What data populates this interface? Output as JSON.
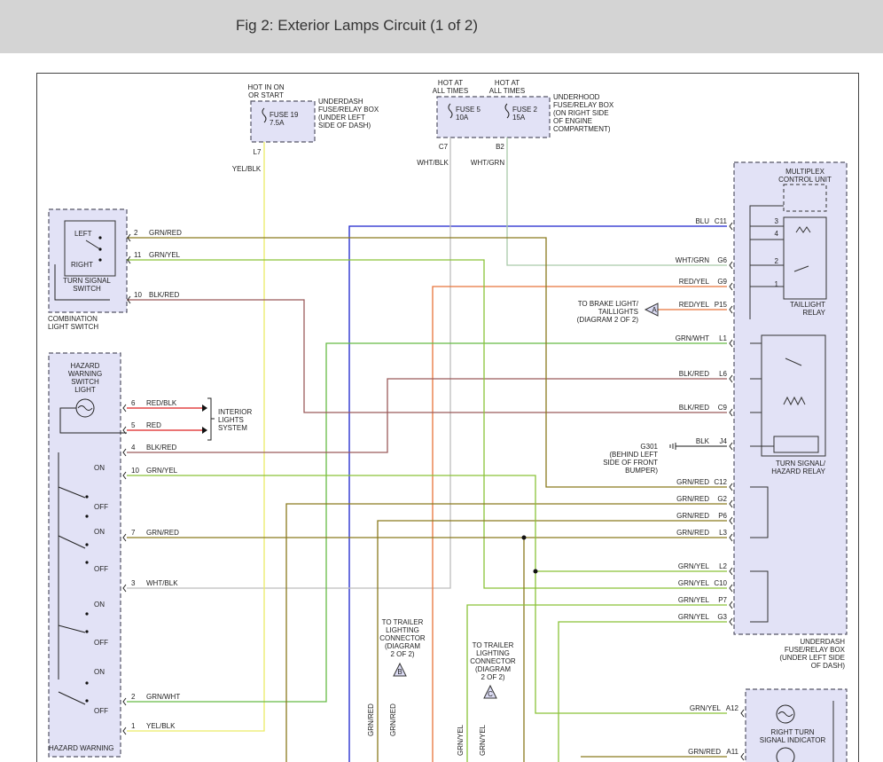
{
  "header": {
    "title": "Fig 2: Exterior Lamps Circuit (1 of 2)"
  },
  "colors": {
    "box_fill": "#e2e2f6",
    "box_border": "#555566",
    "grn_red": "#8a7a1e",
    "grn_yel": "#8ac238",
    "blk_red": "#9b5a5a",
    "blu": "#1a22cc",
    "wht": "#bdbdbd",
    "yel_blk": "#ecec66",
    "red": "#dd2222",
    "red_yel": "#e8743a",
    "grn_wht": "#66bb44"
  },
  "labels": [
    {
      "id": "hot-on-or-start",
      "lines": [
        "HOT IN ON",
        "OR START"
      ]
    },
    {
      "id": "fuse19",
      "lines": [
        "FUSE 19",
        "7.5A"
      ]
    },
    {
      "id": "underdash-box-top",
      "lines": [
        "UNDERDASH",
        "FUSE/RELAY BOX",
        "(UNDER LEFT",
        "SIDE OF DASH)"
      ]
    },
    {
      "id": "pin-l7",
      "lines": [
        "L7"
      ]
    },
    {
      "id": "wire-yelblk-top",
      "lines": [
        "YEL/BLK"
      ]
    },
    {
      "id": "hot-all-times-1",
      "lines": [
        "HOT AT",
        "ALL TIMES"
      ]
    },
    {
      "id": "hot-all-times-2",
      "lines": [
        "HOT AT",
        "ALL TIMES"
      ]
    },
    {
      "id": "fuse5",
      "lines": [
        "FUSE 5",
        "10A"
      ]
    },
    {
      "id": "fuse2",
      "lines": [
        "FUSE 2",
        "15A"
      ]
    },
    {
      "id": "underhood-box",
      "lines": [
        "UNDERHOOD",
        "FUSE/RELAY BOX",
        "(ON RIGHT SIDE",
        "OF ENGINE",
        "COMPARTMENT)"
      ]
    },
    {
      "id": "pin-c7",
      "lines": [
        "C7"
      ]
    },
    {
      "id": "pin-b2",
      "lines": [
        "B2"
      ]
    },
    {
      "id": "wire-whtblk-top",
      "lines": [
        "WHT/BLK"
      ]
    },
    {
      "id": "wire-whtgrn-top",
      "lines": [
        "WHT/GRN"
      ]
    },
    {
      "id": "multiplex",
      "lines": [
        "MULTIPLEX",
        "CONTROL UNIT"
      ]
    },
    {
      "id": "taillight-relay",
      "lines": [
        "TAILLIGHT",
        "RELAY"
      ]
    },
    {
      "id": "turn-hazard-relay",
      "lines": [
        "TURN SIGNAL/",
        "HAZARD RELAY"
      ]
    },
    {
      "id": "underdash-box-right",
      "lines": [
        "UNDERDASH",
        "FUSE/RELAY BOX",
        "(UNDER LEFT SIDE",
        "OF DASH)"
      ]
    },
    {
      "id": "left",
      "lines": [
        "LEFT"
      ]
    },
    {
      "id": "right",
      "lines": [
        "RIGHT"
      ]
    },
    {
      "id": "turn-signal-switch",
      "lines": [
        "TURN SIGNAL",
        "SWITCH"
      ]
    },
    {
      "id": "combination-switch",
      "lines": [
        "COMBINATION",
        "LIGHT SWITCH"
      ]
    },
    {
      "id": "hazard-switch-light",
      "lines": [
        "HAZARD",
        "WARNING",
        "SWITCH",
        "LIGHT"
      ]
    },
    {
      "id": "interior-lights",
      "lines": [
        "INTERIOR",
        "LIGHTS",
        "SYSTEM"
      ]
    },
    {
      "id": "to-brake-light",
      "lines": [
        "TO BRAKE LIGHT/",
        "TAILLIGHTS",
        "(DIAGRAM 2 OF 2)"
      ]
    },
    {
      "id": "g301",
      "lines": [
        "G301",
        "(BEHIND LEFT",
        "SIDE OF FRONT",
        "BUMPER)"
      ]
    },
    {
      "id": "trailer-b",
      "lines": [
        "TO TRAILER",
        "LIGHTING",
        "CONNECTOR",
        "(DIAGRAM",
        "2 OF 2)"
      ]
    },
    {
      "id": "trailer-c",
      "lines": [
        "TO TRAILER",
        "LIGHTING",
        "CONNECTOR",
        "(DIAGRAM",
        "2 OF 2)"
      ]
    },
    {
      "id": "right-turn-indicator",
      "lines": [
        "RIGHT TURN",
        "SIGNAL INDICATOR"
      ]
    },
    {
      "id": "hazard-warning-bottom",
      "lines": [
        "HAZARD WARNING"
      ]
    },
    {
      "id": "on1",
      "lines": [
        "ON"
      ]
    },
    {
      "id": "off1",
      "lines": [
        "OFF"
      ]
    },
    {
      "id": "on2",
      "lines": [
        "ON"
      ]
    },
    {
      "id": "off2",
      "lines": [
        "OFF"
      ]
    },
    {
      "id": "on3",
      "lines": [
        "ON"
      ]
    },
    {
      "id": "off3",
      "lines": [
        "OFF"
      ]
    },
    {
      "id": "on4",
      "lines": [
        "ON"
      ]
    },
    {
      "id": "off4",
      "lines": [
        "OFF"
      ]
    },
    {
      "id": "flag-a",
      "lines": [
        "A"
      ]
    },
    {
      "id": "flag-b",
      "lines": [
        "B"
      ]
    },
    {
      "id": "flag-c",
      "lines": [
        "C"
      ]
    }
  ],
  "right_wires": [
    {
      "pin": "C11",
      "color": "BLU"
    },
    {
      "pin": "G6",
      "color": "WHT/GRN"
    },
    {
      "pin": "G9",
      "color": "RED/YEL"
    },
    {
      "pin": "P15",
      "color": "RED/YEL"
    },
    {
      "pin": "L1",
      "color": "GRN/WHT"
    },
    {
      "pin": "L6",
      "color": "BLK/RED"
    },
    {
      "pin": "C9",
      "color": "BLK/RED"
    },
    {
      "pin": "J4",
      "color": "BLK"
    },
    {
      "pin": "C12",
      "color": "GRN/RED"
    },
    {
      "pin": "G2",
      "color": "GRN/RED"
    },
    {
      "pin": "P6",
      "color": "GRN/RED"
    },
    {
      "pin": "L3",
      "color": "GRN/RED"
    },
    {
      "pin": "L2",
      "color": "GRN/YEL"
    },
    {
      "pin": "C10",
      "color": "GRN/YEL"
    },
    {
      "pin": "P7",
      "color": "GRN/YEL"
    },
    {
      "pin": "G3",
      "color": "GRN/YEL"
    },
    {
      "pin": "A12",
      "color": "GRN/YEL"
    },
    {
      "pin": "A11",
      "color": "GRN/RED"
    }
  ],
  "left_wires": [
    {
      "pin": "2",
      "color": "GRN/RED"
    },
    {
      "pin": "11",
      "color": "GRN/YEL"
    },
    {
      "pin": "10",
      "color": "BLK/RED"
    },
    {
      "pin": "6",
      "color": "RED/BLK"
    },
    {
      "pin": "5",
      "color": "RED"
    },
    {
      "pin": "4",
      "color": "BLK/RED"
    },
    {
      "pin": "10",
      "color": "GRN/YEL"
    },
    {
      "pin": "7",
      "color": "GRN/RED"
    },
    {
      "pin": "3",
      "color": "WHT/BLK"
    },
    {
      "pin": "2",
      "color": "GRN/WHT"
    },
    {
      "pin": "1",
      "color": "YEL/BLK"
    }
  ],
  "relay_pins": [
    "3",
    "4",
    "2",
    "1"
  ],
  "vertical_wire_labels": [
    "GRN/RED",
    "GRN/RED",
    "GRN/YEL",
    "GRN/YEL"
  ]
}
